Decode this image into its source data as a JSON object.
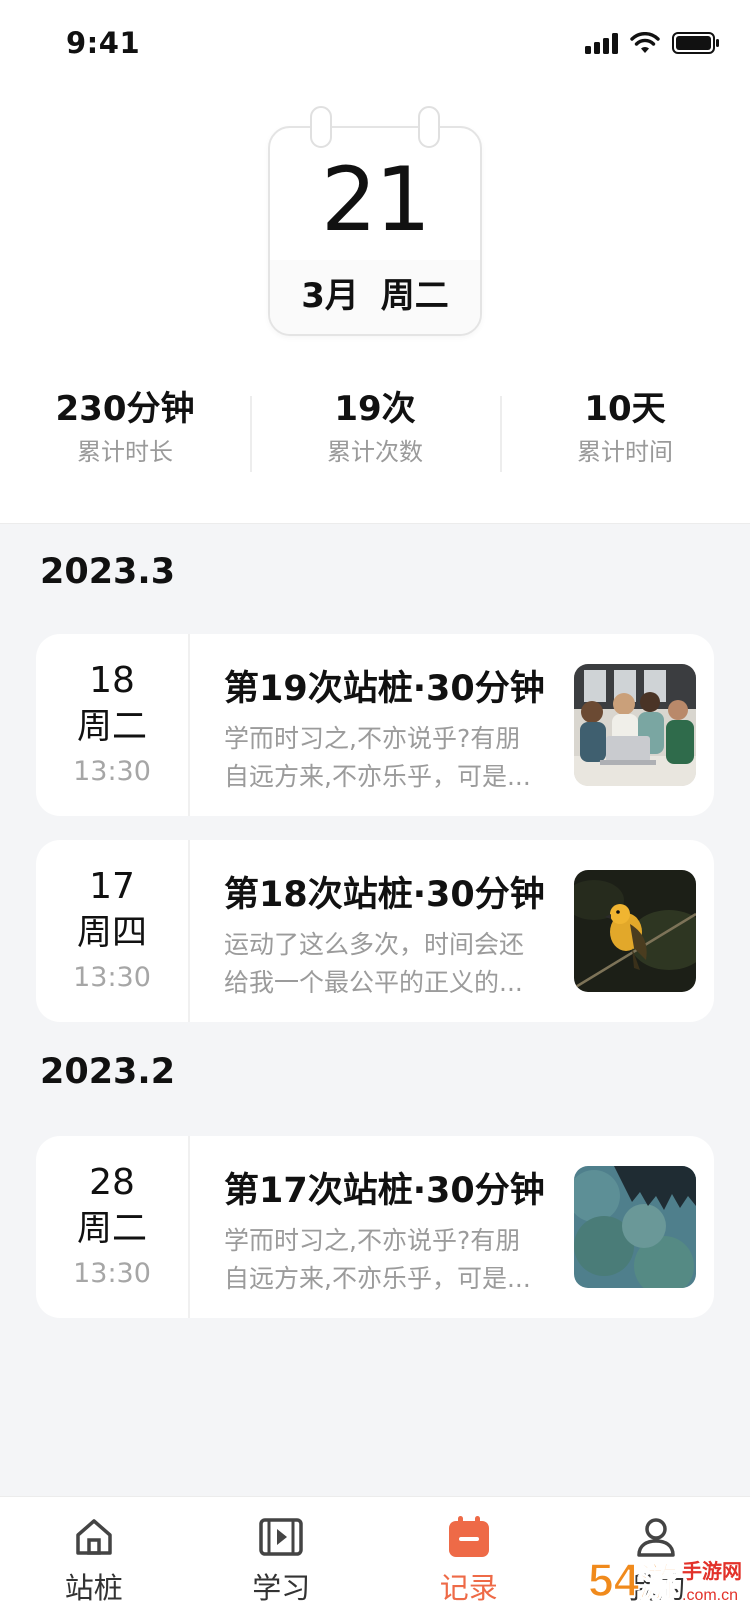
{
  "status_bar": {
    "time": "9:41"
  },
  "calendar": {
    "day": "21",
    "month": "3月",
    "weekday": "周二"
  },
  "stats": [
    {
      "value": "230分钟",
      "label": "累计时长"
    },
    {
      "value": "19次",
      "label": "累计次数"
    },
    {
      "value": "10天",
      "label": "累计时间"
    }
  ],
  "groups": [
    {
      "month": "2023.3",
      "records": [
        {
          "day": "18",
          "weekday": "周二",
          "time": "13:30",
          "title": "第19次站桩·30分钟",
          "desc_line1": "学而时习之,不亦说乎?有朋",
          "desc_line2": "自远方来,不亦乐乎，可是...",
          "thumb": "people-laptop-photo"
        },
        {
          "day": "17",
          "weekday": "周四",
          "time": "13:30",
          "title": "第18次站桩·30分钟",
          "desc_line1": "运动了这么多次，时间会还",
          "desc_line2": "给我一个最公平的正义的...",
          "thumb": "yellow-bird-photo"
        }
      ]
    },
    {
      "month": "2023.2",
      "records": [
        {
          "day": "28",
          "weekday": "周二",
          "time": "13:30",
          "title": "第17次站桩·30分钟",
          "desc_line1": "学而时习之,不亦说乎?有朋",
          "desc_line2": "自远方来,不亦乐乎，可是...",
          "thumb": "blue-forest-photo"
        }
      ]
    }
  ],
  "tabbar": {
    "items": [
      {
        "label": "站桩",
        "icon": "home-icon"
      },
      {
        "label": "学习",
        "icon": "video-icon"
      },
      {
        "label": "记录",
        "icon": "calendar-icon",
        "active": true
      },
      {
        "label": "我的",
        "icon": "user-icon"
      }
    ],
    "active_color": "#ee6a47"
  },
  "watermark": {
    "text": "54游 手游网 .com.cn"
  }
}
